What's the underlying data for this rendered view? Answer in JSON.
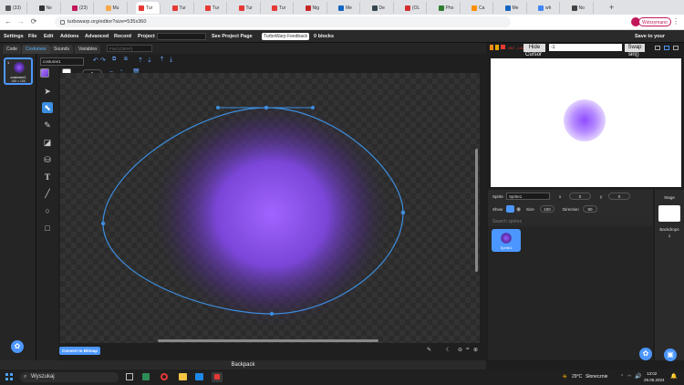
{
  "browser": {
    "tabs": [
      {
        "label": "(33)",
        "color": "#555"
      },
      {
        "label": "Ne",
        "color": "#333"
      },
      {
        "label": "(23)",
        "color": "#c2185b"
      },
      {
        "label": "Mu",
        "color": "#f7a94b"
      },
      {
        "label": "Tur",
        "color": "#e53935"
      },
      {
        "label": "Tur",
        "color": "#e53935"
      },
      {
        "label": "Tur",
        "color": "#e53935"
      },
      {
        "label": "Tur",
        "color": "#e53935"
      },
      {
        "label": "Tur",
        "color": "#e53935"
      },
      {
        "label": "Nig",
        "color": "#c62828"
      },
      {
        "label": "Me",
        "color": "#1565c0"
      },
      {
        "label": "De",
        "color": "#37474f"
      },
      {
        "label": "(OL",
        "color": "#d32f2f"
      },
      {
        "label": "Pho",
        "color": "#2e7d32"
      },
      {
        "label": "Ca",
        "color": "#ff8f00"
      },
      {
        "label": "Me",
        "color": "#1565c0"
      },
      {
        "label": "wh",
        "color": "#4285f4"
      },
      {
        "label": "No",
        "color": "#444"
      }
    ],
    "url": "turbowarp.org/editor?size=535x360",
    "profile_label": "Wstrzymano"
  },
  "menubar": {
    "items": [
      "Settings",
      "File",
      "Edit",
      "Addons",
      "Advanced",
      "Record",
      "Project"
    ],
    "see_project_page": "See Project Page",
    "feedback": "TurboWarp Feedback",
    "blocks": "0 blocks",
    "save": "Save to your computer"
  },
  "editor_tabs": {
    "code": "Code",
    "costumes": "Costumes",
    "sounds": "Sounds",
    "variables": "Variables",
    "find": "Find (Ctrl+F)"
  },
  "costume": {
    "name": "costume1",
    "index": "1",
    "thumb_label": "costume1",
    "thumb_size": "188 x 188",
    "outline_width": "0"
  },
  "stage_controls": {
    "readout": "-987, -143",
    "hide_label": "Hide",
    "cursor_label": "Cursor",
    "input_value": "-1",
    "swap_label": "Swap",
    "sin_label": "sin()"
  },
  "sprite_info": {
    "sprite_label": "Sprite",
    "sprite_name": "Sprite1",
    "x_label": "x",
    "x_value": "0",
    "y_label": "y",
    "y_value": "0",
    "show_label": "Show",
    "size_label": "Size",
    "size_value": "100",
    "direction_label": "Direction",
    "direction_value": "90"
  },
  "sprite_list": {
    "search_placeholder": "Search sprites",
    "sprites": [
      {
        "name": "Sprite1"
      }
    ]
  },
  "stage_panel": {
    "stage_label": "Stage",
    "backdrops_label": "Backdrops",
    "backdrops_count": "1"
  },
  "convert_button": "Convert to Bitmap",
  "backpack": "Backpack",
  "taskbar": {
    "search": "Wyszukaj",
    "weather": "29°C",
    "weather_desc": "Słonecznie",
    "time": "13:02",
    "date": "29.06.2024"
  },
  "colors": {
    "accent": "#4c97ff",
    "selection": "#3c8ee0",
    "stage_bg": "#ffffff"
  }
}
